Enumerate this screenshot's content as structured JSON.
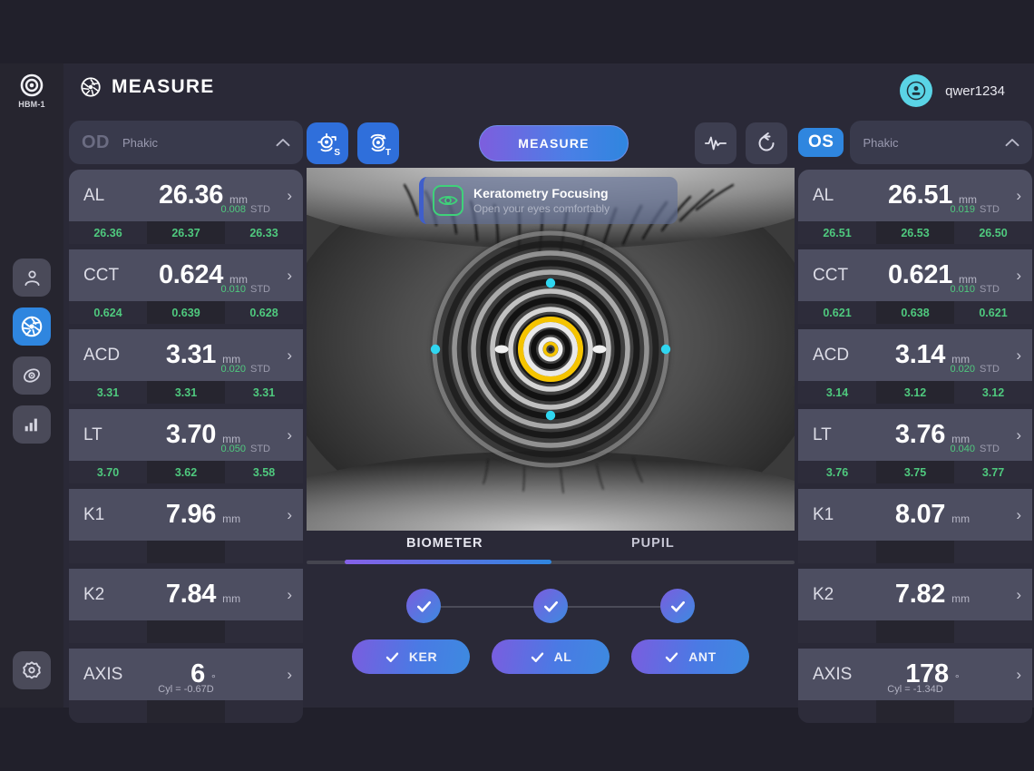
{
  "device": {
    "logo_icon": "concentric-target-icon",
    "name": "HBM-1"
  },
  "header": {
    "icon": "aperture-icon",
    "title": "MEASURE",
    "avatar_icon": "user-avatar-icon",
    "username": "qwer1234"
  },
  "sidebar": {
    "items": [
      {
        "icon": "person-icon",
        "name": "patient",
        "active": false
      },
      {
        "icon": "aperture-icon",
        "name": "measure",
        "active": true
      },
      {
        "icon": "eye-target-icon",
        "name": "review",
        "active": false
      },
      {
        "icon": "bar-chart-icon",
        "name": "statistics",
        "active": false
      }
    ],
    "settings": {
      "icon": "gear-icon",
      "name": "settings"
    }
  },
  "toolbar": {
    "scan_button": {
      "icon": "target-scan-icon",
      "badge": "S"
    },
    "track_button": {
      "icon": "target-rotate-icon",
      "badge": "T"
    },
    "measure_label": "MEASURE",
    "waveform_button": {
      "icon": "waveform-icon"
    },
    "reset_button": {
      "icon": "reset-arrow-icon"
    }
  },
  "overlay": {
    "icon": "eye-focus-icon",
    "title": "Keratometry Focusing",
    "subtitle": "Open your eyes comfortably"
  },
  "od_panel": {
    "eye_tag": "OD",
    "active": false,
    "status": "Phakic",
    "chevron": "chevron-up-icon",
    "rows": [
      {
        "label": "AL",
        "value": "26.36",
        "unit": "mm",
        "std": "0.008",
        "std_label": "STD",
        "subvalues": [
          "26.36",
          "26.37",
          "26.33"
        ]
      },
      {
        "label": "CCT",
        "value": "0.624",
        "unit": "mm",
        "std": "0.010",
        "std_label": "STD",
        "subvalues": [
          "0.624",
          "0.639",
          "0.628"
        ]
      },
      {
        "label": "ACD",
        "value": "3.31",
        "unit": "mm",
        "std": "0.020",
        "std_label": "STD",
        "subvalues": [
          "3.31",
          "3.31",
          "3.31"
        ]
      },
      {
        "label": "LT",
        "value": "3.70",
        "unit": "mm",
        "std": "0.050",
        "std_label": "STD",
        "subvalues": [
          "3.70",
          "3.62",
          "3.58"
        ]
      },
      {
        "label": "K1",
        "value": "7.96",
        "unit": "mm",
        "std": "",
        "std_label": "",
        "subvalues": [
          "",
          "",
          ""
        ]
      },
      {
        "label": "K2",
        "value": "7.84",
        "unit": "mm",
        "std": "",
        "std_label": "",
        "subvalues": [
          "",
          "",
          ""
        ]
      },
      {
        "label": "AXIS",
        "value": "6",
        "unit": "°",
        "cyl": "Cyl = -0.67D",
        "subvalues": [
          "",
          "",
          ""
        ]
      }
    ]
  },
  "os_panel": {
    "eye_tag": "OS",
    "active": true,
    "status": "Phakic",
    "chevron": "chevron-up-icon",
    "rows": [
      {
        "label": "AL",
        "value": "26.51",
        "unit": "mm",
        "std": "0.019",
        "std_label": "STD",
        "subvalues": [
          "26.51",
          "26.53",
          "26.50"
        ]
      },
      {
        "label": "CCT",
        "value": "0.621",
        "unit": "mm",
        "std": "0.010",
        "std_label": "STD",
        "subvalues": [
          "0.621",
          "0.638",
          "0.621"
        ]
      },
      {
        "label": "ACD",
        "value": "3.14",
        "unit": "mm",
        "std": "0.020",
        "std_label": "STD",
        "subvalues": [
          "3.14",
          "3.12",
          "3.12"
        ]
      },
      {
        "label": "LT",
        "value": "3.76",
        "unit": "mm",
        "std": "0.040",
        "std_label": "STD",
        "subvalues": [
          "3.76",
          "3.75",
          "3.77"
        ]
      },
      {
        "label": "K1",
        "value": "8.07",
        "unit": "mm",
        "std": "",
        "std_label": "",
        "subvalues": [
          "",
          "",
          ""
        ]
      },
      {
        "label": "K2",
        "value": "7.82",
        "unit": "mm",
        "std": "",
        "std_label": "",
        "subvalues": [
          "",
          "",
          ""
        ]
      },
      {
        "label": "AXIS",
        "value": "178",
        "unit": "°",
        "cyl": "Cyl = -1.34D",
        "subvalues": [
          "",
          "",
          ""
        ]
      }
    ]
  },
  "tabs": [
    {
      "label": "BIOMETER",
      "active": true
    },
    {
      "label": "PUPIL",
      "active": false
    }
  ],
  "steps": [
    {
      "icon": "check-icon",
      "done": true
    },
    {
      "icon": "check-icon",
      "done": true
    },
    {
      "icon": "check-icon",
      "done": true
    }
  ],
  "actions": [
    {
      "label": "KER",
      "icon": "check-icon",
      "done": true
    },
    {
      "label": "AL",
      "icon": "check-icon",
      "done": true
    },
    {
      "label": "ANT",
      "icon": "check-icon",
      "done": true
    }
  ],
  "colors": {
    "background": "#21202b",
    "surface": "#2a2937",
    "row": "#4d4e61",
    "accent_blue": "#2f86df",
    "accent_purple": "#7d5ede",
    "green": "#4fc97e",
    "cyan": "#5ad4e6",
    "yellow_ring": "#f5c400"
  }
}
